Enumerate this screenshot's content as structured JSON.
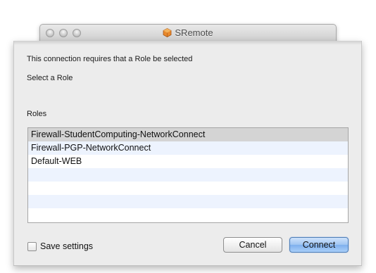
{
  "parent_window": {
    "title": "SRemote",
    "app_icon": "sremote-app-icon"
  },
  "sheet": {
    "message": "This connection requires that a Role be selected",
    "prompt": "Select a Role",
    "list_label": "Roles",
    "roles": [
      "Firewall-StudentComputing-NetworkConnect",
      "Firewall-PGP-NetworkConnect",
      "Default-WEB"
    ],
    "selected_role": "Firewall-StudentComputing-NetworkConnect",
    "save_settings_label": "Save settings",
    "save_settings_checked": false,
    "cancel_label": "Cancel",
    "connect_label": "Connect"
  },
  "colors": {
    "default_button": "#7fb0ee",
    "selected_row": "#d4d4d4",
    "alt_row": "#edf3fe",
    "sheet_background": "#ececec"
  }
}
